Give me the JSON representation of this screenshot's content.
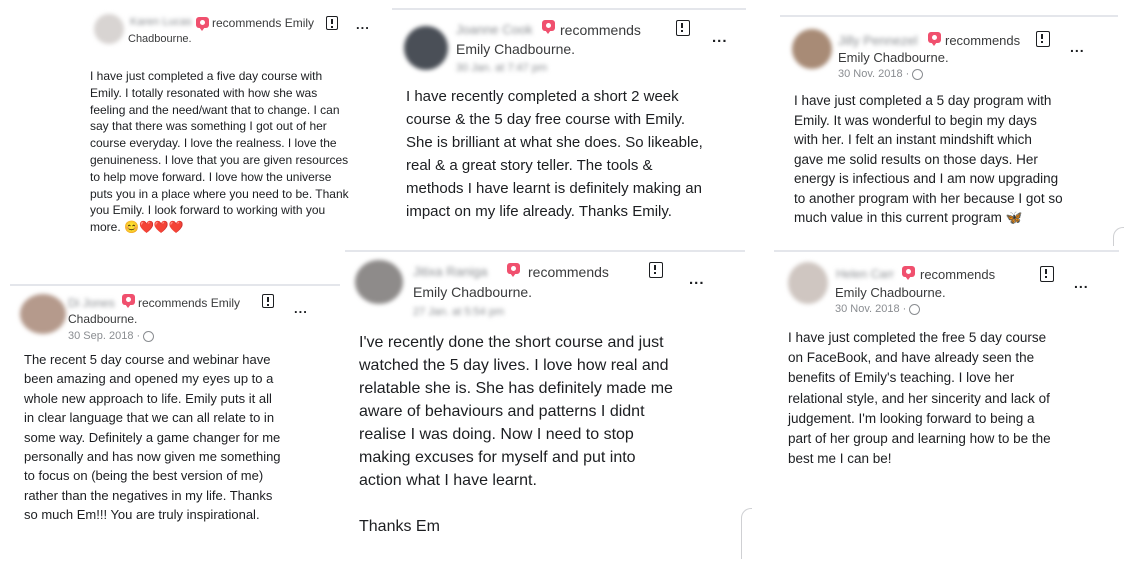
{
  "recommends_text": "recommends",
  "page_name": "Emily Chadbourne.",
  "reviews": [
    {
      "reviewer": "Karen Lucas",
      "head_suffix": "Emily",
      "page_line": "Chadbourne.",
      "date": "",
      "body": "I have just completed a five day course with\nEmily.  I totally resonated with how she was\nfeeling and the need/want that to change.  I can\nsay that there was something I got out of her\ncourse everyday.  I love the realness. I love the\ngenuineness. I love that you are given resources\nto help move forward. I love how the universe\nputs you in a place where you need to be. Thank\nyou  Emily.  I look forward to working with you\nmore.  😊❤️❤️❤️"
    },
    {
      "reviewer": "Joanne Cook",
      "head_suffix": "",
      "page_line": "Emily Chadbourne.",
      "date": "30 Jan. at 7:47 pm",
      "body": "I have recently completed a short 2 week\ncourse & the 5 day free course with Emily.\nShe is brilliant at what she does. So likeable,\nreal & a great story teller. The tools &\nmethods I have learnt is definitely making an\nimpact on my life already. Thanks Emily."
    },
    {
      "reviewer": "Jilly Pennezel",
      "head_suffix": "",
      "page_line": "Emily Chadbourne.",
      "date": "30 Nov. 2018 ·",
      "body": "I have just completed a 5 day program with\nEmily. It was wonderful to begin my days\nwith her. I felt an instant mindshift which\ngave me solid results on those days. Her\nenergy is infectious and I am now upgrading\nto another program with her because I got so\nmuch value in this current program 🦋"
    },
    {
      "reviewer": "Di Jones",
      "head_suffix": "Emily",
      "page_line": "Chadbourne.",
      "date": "30 Sep. 2018 ·",
      "body": "The recent 5 day course and webinar have\nbeen amazing and opened my eyes up to a\nwhole new approach to life. Emily puts it all\nin clear language that we can all relate to in\nsome way. Definitely a game changer for me\npersonally and has now given me something\nto focus on (being the best version of me)\nrather than the negatives in my life. Thanks\nso much Em!!! You are truly inspirational."
    },
    {
      "reviewer": "Jitixa Raniga",
      "head_suffix": "",
      "page_line": "Emily Chadbourne.",
      "date": "27 Jan. at 5:54 pm",
      "body": "I've recently done the short course and just\nwatched the 5 day lives. I love how real and\nrelatable she is. She has definitely made me\naware of behaviours and patterns I didnt\nrealise I was doing. Now I need to stop\nmaking excuses for myself and put into\naction what I have learnt.\n\nThanks Em"
    },
    {
      "reviewer": "Helen Carr",
      "head_suffix": "",
      "page_line": "Emily Chadbourne.",
      "date": "30 Nov. 2018 ·",
      "body": "I have just completed the free 5 day course\non FaceBook, and have already seen the\nbenefits of Emily's teaching. I love her\nrelational style, and her sincerity and lack of\njudgement. I'm looking forward to being a\npart of her group and learning how to be the\nbest me I can be!"
    }
  ]
}
